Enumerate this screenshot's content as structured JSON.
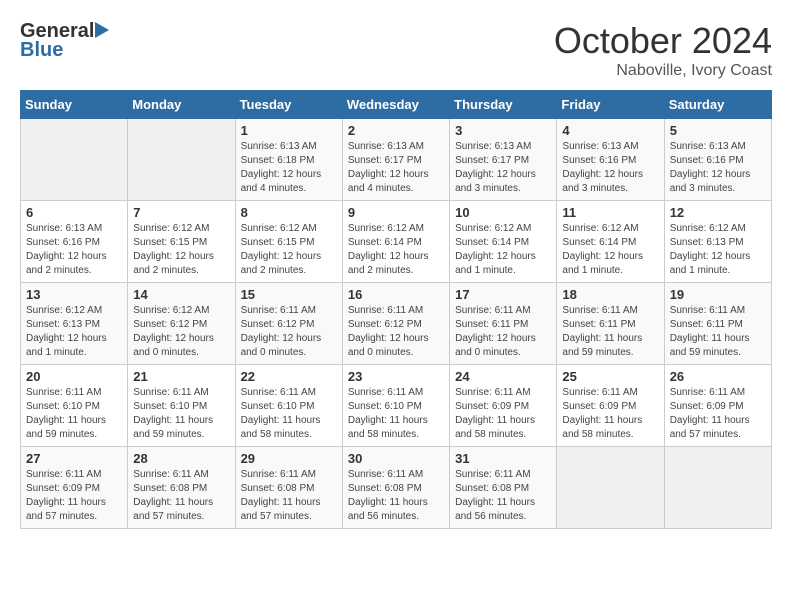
{
  "header": {
    "logo_general": "General",
    "logo_blue": "Blue",
    "month_title": "October 2024",
    "location": "Naboville, Ivory Coast"
  },
  "weekdays": [
    "Sunday",
    "Monday",
    "Tuesday",
    "Wednesday",
    "Thursday",
    "Friday",
    "Saturday"
  ],
  "weeks": [
    [
      {
        "day": "",
        "empty": true
      },
      {
        "day": "",
        "empty": true
      },
      {
        "day": "1",
        "sunrise": "6:13 AM",
        "sunset": "6:18 PM",
        "daylight": "12 hours and 4 minutes."
      },
      {
        "day": "2",
        "sunrise": "6:13 AM",
        "sunset": "6:17 PM",
        "daylight": "12 hours and 4 minutes."
      },
      {
        "day": "3",
        "sunrise": "6:13 AM",
        "sunset": "6:17 PM",
        "daylight": "12 hours and 3 minutes."
      },
      {
        "day": "4",
        "sunrise": "6:13 AM",
        "sunset": "6:16 PM",
        "daylight": "12 hours and 3 minutes."
      },
      {
        "day": "5",
        "sunrise": "6:13 AM",
        "sunset": "6:16 PM",
        "daylight": "12 hours and 3 minutes."
      }
    ],
    [
      {
        "day": "6",
        "sunrise": "6:13 AM",
        "sunset": "6:16 PM",
        "daylight": "12 hours and 2 minutes."
      },
      {
        "day": "7",
        "sunrise": "6:12 AM",
        "sunset": "6:15 PM",
        "daylight": "12 hours and 2 minutes."
      },
      {
        "day": "8",
        "sunrise": "6:12 AM",
        "sunset": "6:15 PM",
        "daylight": "12 hours and 2 minutes."
      },
      {
        "day": "9",
        "sunrise": "6:12 AM",
        "sunset": "6:14 PM",
        "daylight": "12 hours and 2 minutes."
      },
      {
        "day": "10",
        "sunrise": "6:12 AM",
        "sunset": "6:14 PM",
        "daylight": "12 hours and 1 minute."
      },
      {
        "day": "11",
        "sunrise": "6:12 AM",
        "sunset": "6:14 PM",
        "daylight": "12 hours and 1 minute."
      },
      {
        "day": "12",
        "sunrise": "6:12 AM",
        "sunset": "6:13 PM",
        "daylight": "12 hours and 1 minute."
      }
    ],
    [
      {
        "day": "13",
        "sunrise": "6:12 AM",
        "sunset": "6:13 PM",
        "daylight": "12 hours and 1 minute."
      },
      {
        "day": "14",
        "sunrise": "6:12 AM",
        "sunset": "6:12 PM",
        "daylight": "12 hours and 0 minutes."
      },
      {
        "day": "15",
        "sunrise": "6:11 AM",
        "sunset": "6:12 PM",
        "daylight": "12 hours and 0 minutes."
      },
      {
        "day": "16",
        "sunrise": "6:11 AM",
        "sunset": "6:12 PM",
        "daylight": "12 hours and 0 minutes."
      },
      {
        "day": "17",
        "sunrise": "6:11 AM",
        "sunset": "6:11 PM",
        "daylight": "12 hours and 0 minutes."
      },
      {
        "day": "18",
        "sunrise": "6:11 AM",
        "sunset": "6:11 PM",
        "daylight": "11 hours and 59 minutes."
      },
      {
        "day": "19",
        "sunrise": "6:11 AM",
        "sunset": "6:11 PM",
        "daylight": "11 hours and 59 minutes."
      }
    ],
    [
      {
        "day": "20",
        "sunrise": "6:11 AM",
        "sunset": "6:10 PM",
        "daylight": "11 hours and 59 minutes."
      },
      {
        "day": "21",
        "sunrise": "6:11 AM",
        "sunset": "6:10 PM",
        "daylight": "11 hours and 59 minutes."
      },
      {
        "day": "22",
        "sunrise": "6:11 AM",
        "sunset": "6:10 PM",
        "daylight": "11 hours and 58 minutes."
      },
      {
        "day": "23",
        "sunrise": "6:11 AM",
        "sunset": "6:10 PM",
        "daylight": "11 hours and 58 minutes."
      },
      {
        "day": "24",
        "sunrise": "6:11 AM",
        "sunset": "6:09 PM",
        "daylight": "11 hours and 58 minutes."
      },
      {
        "day": "25",
        "sunrise": "6:11 AM",
        "sunset": "6:09 PM",
        "daylight": "11 hours and 58 minutes."
      },
      {
        "day": "26",
        "sunrise": "6:11 AM",
        "sunset": "6:09 PM",
        "daylight": "11 hours and 57 minutes."
      }
    ],
    [
      {
        "day": "27",
        "sunrise": "6:11 AM",
        "sunset": "6:09 PM",
        "daylight": "11 hours and 57 minutes."
      },
      {
        "day": "28",
        "sunrise": "6:11 AM",
        "sunset": "6:08 PM",
        "daylight": "11 hours and 57 minutes."
      },
      {
        "day": "29",
        "sunrise": "6:11 AM",
        "sunset": "6:08 PM",
        "daylight": "11 hours and 57 minutes."
      },
      {
        "day": "30",
        "sunrise": "6:11 AM",
        "sunset": "6:08 PM",
        "daylight": "11 hours and 56 minutes."
      },
      {
        "day": "31",
        "sunrise": "6:11 AM",
        "sunset": "6:08 PM",
        "daylight": "11 hours and 56 minutes."
      },
      {
        "day": "",
        "empty": true
      },
      {
        "day": "",
        "empty": true
      }
    ]
  ],
  "labels": {
    "sunrise_prefix": "Sunrise:",
    "sunset_prefix": "Sunset:",
    "daylight_prefix": "Daylight:"
  }
}
